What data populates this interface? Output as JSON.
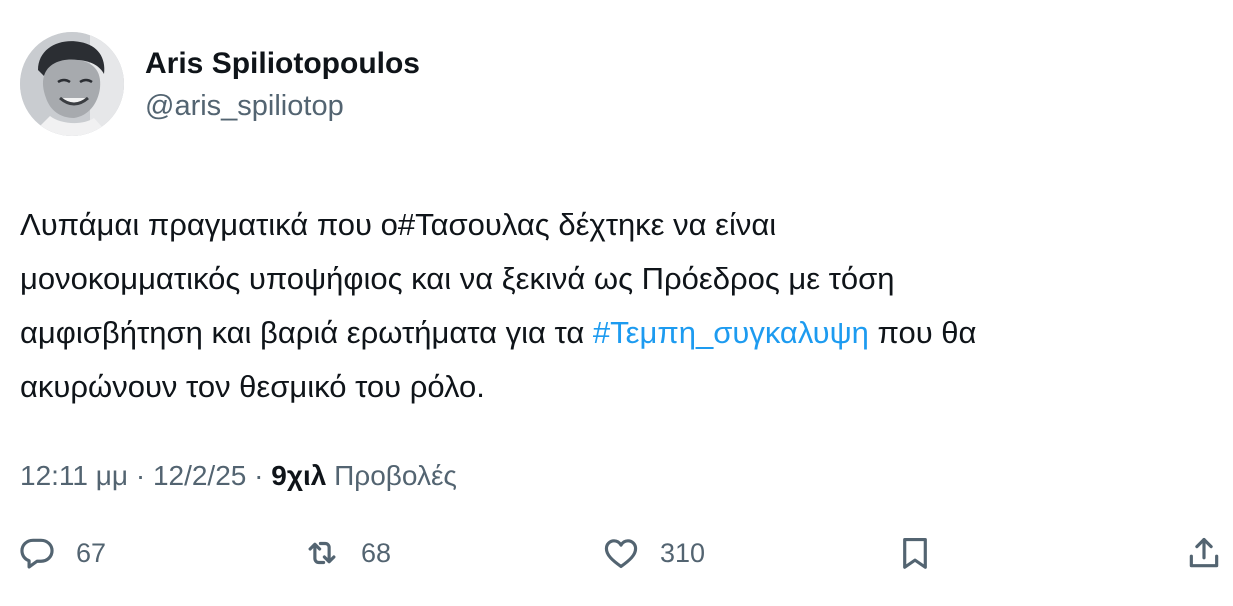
{
  "author": {
    "name": "Aris Spiliotopoulos",
    "handle": "@aris_spiliotop"
  },
  "tweet": {
    "line1_pre": "Λυπάμαι πραγματικά που ο#Τασουλας δέχτηκε να είναι",
    "line2": "μονοκομματικός υποψήφιος και να ξεκινά ως Πρόεδρος με τόση",
    "line3_pre": "αμφισβήτηση και βαριά ερωτήματα για τα ",
    "hashtag": "#Τεμπη_συγκαλυψη",
    "line3_post": " που θα",
    "line4": "ακυρώνουν τον θεσμικό του ρόλο.",
    "hashtag_color": "#1d9bf0"
  },
  "meta": {
    "time": "12:11 μμ",
    "separator": " · ",
    "date": "12/2/25",
    "views_count": "9χιλ",
    "views_label": " Προβολές"
  },
  "actions": {
    "replies": "67",
    "reposts": "68",
    "likes": "310"
  },
  "icons": {
    "reply": "speech-bubble-icon",
    "repost": "repost-arrows-icon",
    "like": "heart-icon",
    "bookmark": "bookmark-icon",
    "share": "share-upload-icon"
  },
  "colors": {
    "text": "#0f1419",
    "secondary": "#536471",
    "link": "#1d9bf0"
  }
}
